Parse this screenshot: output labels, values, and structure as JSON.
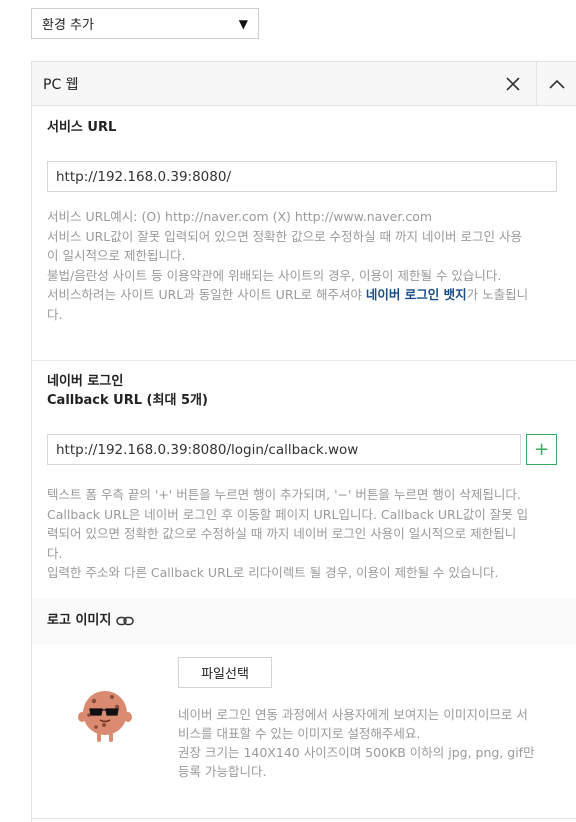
{
  "env_select": {
    "value": "환경 추가"
  },
  "panel": {
    "title": "PC 웹"
  },
  "service_url": {
    "label": "서비스 URL",
    "value": "http://192.168.0.39:8080/",
    "help_1": "서비스 URL예시: (O) http://naver.com (X) http://www.naver.com",
    "help_2": "서비스 URL값이 잘못 입력되어 있으면 정확한 값으로 수정하실 때 까지 네이버 로그인 사용",
    "help_3": "이 일시적으로 제한됩니다.",
    "help_4": "불법/음란성 사이트 등 이용약관에 위배되는 사이트의 경우, 이용이 제한될 수 있습니다.",
    "help_5a": "서비스하려는 사이트 URL과 동일한 사이트 URL로 해주셔야 ",
    "help_5b": "네이버 로그인 뱃지",
    "help_5c": "가 노출됩니",
    "help_6": "다."
  },
  "callback": {
    "label_1": "네이버 로그인",
    "label_2": "Callback URL (최대 5개)",
    "value": "http://192.168.0.39:8080/login/callback.wow",
    "add_label": "+",
    "help_1": "텍스트 폼 우측 끝의 '+' 버튼을 누르면 행이 추가되며, '−' 버튼을 누르면 행이 삭제됩니다.",
    "help_2": "Callback URL은 네이버 로그인 후 이동할 페이지 URL입니다. Callback URL값이 잘못 입",
    "help_3": "력되어 있으면 정확한 값으로 수정하실 때 까지 네이버 로그인 사용이 일시적으로 제한됩니",
    "help_4": "다.",
    "help_5": "입력한 주소와 다른 Callback URL로 리다이렉트 될 경우, 이용이 제한될 수 있습니다."
  },
  "logo": {
    "label": "로고 이미지",
    "file_button": "파일선택",
    "help_1": "네이버 로그인 연동 과정에서 사용자에게 보여지는 이미지이므로 서",
    "help_2": "비스를 대표할 수 있는 이미지로 설정해주세요.",
    "help_3": "권장 크기는 140X140 사이즈이며 500KB 이하의 jpg, png, gif만",
    "help_4": "등록 가능합니다."
  },
  "icons": {
    "dropdown": "caret-down-icon",
    "close": "close-icon",
    "collapse": "chevron-up-icon",
    "link": "link-icon",
    "avatar": "cookie-character-sunglasses"
  },
  "colors": {
    "accent_green": "#3aa860",
    "highlight_blue": "#1a4d86"
  }
}
